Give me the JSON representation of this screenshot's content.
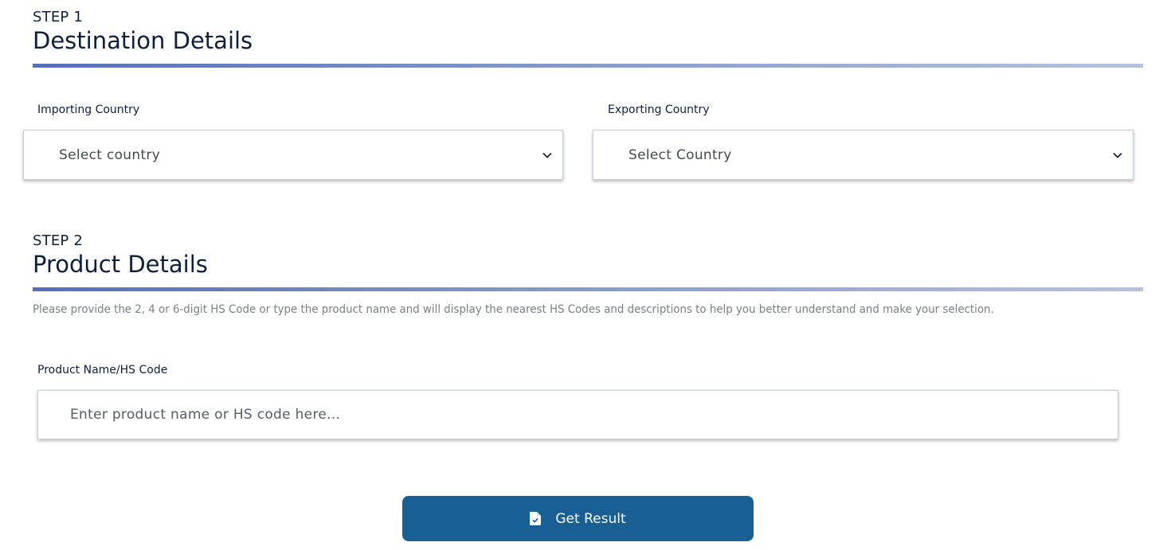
{
  "step1": {
    "kicker": "STEP 1",
    "title": "Destination Details",
    "importing": {
      "label": "Importing Country",
      "selected": "Select country"
    },
    "exporting": {
      "label": "Exporting Country",
      "selected": "Select Country"
    }
  },
  "step2": {
    "kicker": "STEP 2",
    "title": "Product Details",
    "help": "Please provide the 2, 4 or 6-digit HS Code or type the product name and will display the nearest HS Codes and descriptions to help you better understand and make your selection.",
    "product": {
      "label": "Product Name/HS Code",
      "placeholder": "Enter product name or HS code here..."
    }
  },
  "action": {
    "label": "Get Result",
    "icon": "file-check-icon",
    "color": "#185f94"
  },
  "colors": {
    "heading": "#0d1f3c",
    "divider_start": "#5570b8",
    "divider_end": "#b7c2dc"
  }
}
